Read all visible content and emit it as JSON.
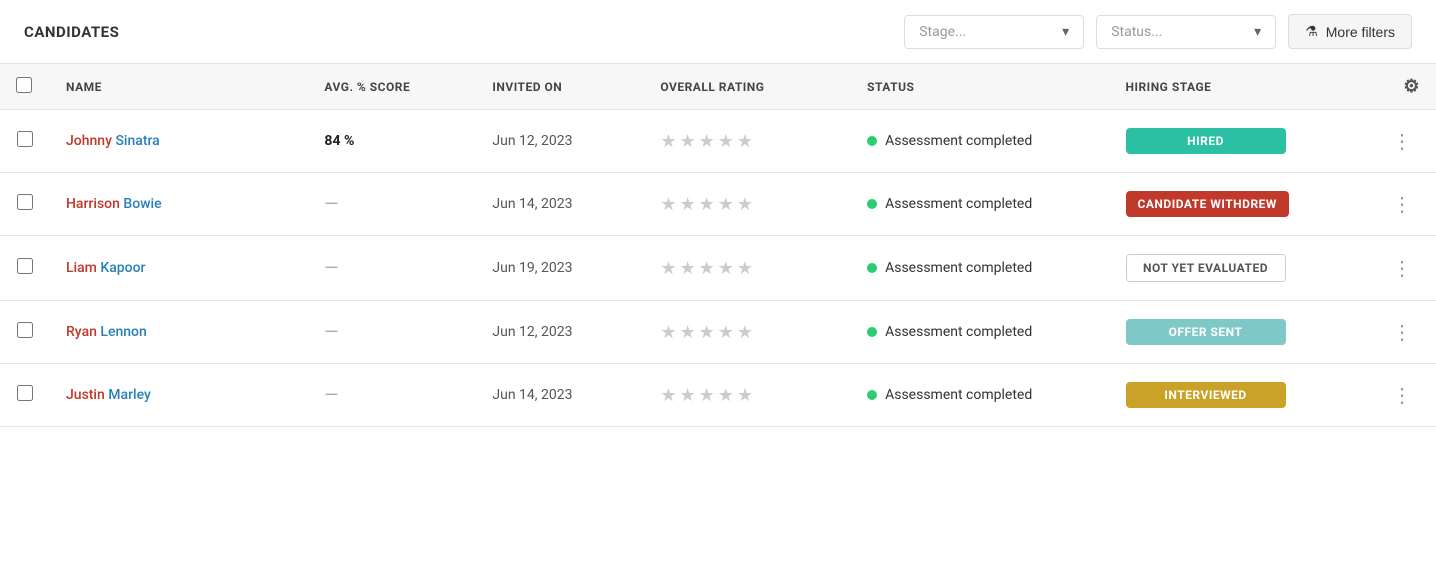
{
  "header": {
    "title": "CANDIDATES",
    "stage_placeholder": "Stage...",
    "status_placeholder": "Status...",
    "more_filters_label": "More filters"
  },
  "columns": {
    "name": "NAME",
    "avg_score": "AVG. % SCORE",
    "invited_on": "INVITED ON",
    "overall_rating": "OVERALL RATING",
    "status": "STATUS",
    "hiring_stage": "HIRING STAGE"
  },
  "candidates": [
    {
      "first_name": "Johnny",
      "last_name": "Sinatra",
      "avg_score": "84 %",
      "has_score": true,
      "invited_on": "Jun 12, 2023",
      "status_text": "Assessment completed",
      "hiring_stage": "HIRED",
      "badge_type": "hired"
    },
    {
      "first_name": "Harrison",
      "last_name": "Bowie",
      "avg_score": "—",
      "has_score": false,
      "invited_on": "Jun 14, 2023",
      "status_text": "Assessment completed",
      "hiring_stage": "CANDIDATE WITHDREW",
      "badge_type": "withdrew"
    },
    {
      "first_name": "Liam",
      "last_name": "Kapoor",
      "avg_score": "—",
      "has_score": false,
      "invited_on": "Jun 19, 2023",
      "status_text": "Assessment completed",
      "hiring_stage": "NOT YET EVALUATED",
      "badge_type": "not-evaluated"
    },
    {
      "first_name": "Ryan",
      "last_name": "Lennon",
      "avg_score": "—",
      "has_score": false,
      "invited_on": "Jun 12, 2023",
      "status_text": "Assessment completed",
      "hiring_stage": "OFFER SENT",
      "badge_type": "offer-sent"
    },
    {
      "first_name": "Justin",
      "last_name": "Marley",
      "avg_score": "—",
      "has_score": false,
      "invited_on": "Jun 14, 2023",
      "status_text": "Assessment completed",
      "hiring_stage": "INTERVIEWED",
      "badge_type": "interviewed"
    }
  ]
}
